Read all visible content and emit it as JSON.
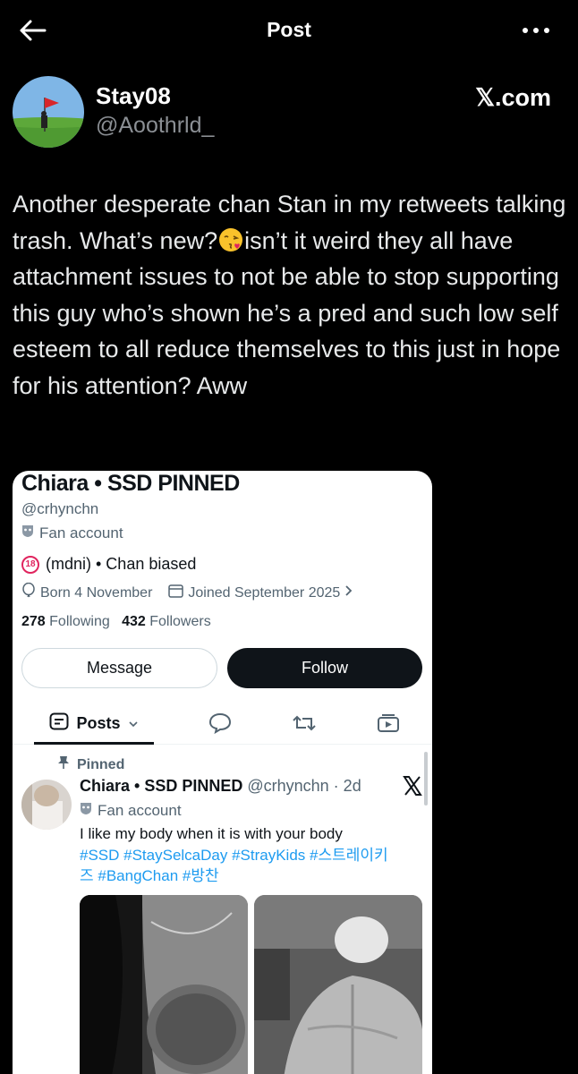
{
  "topbar": {
    "title": "Post"
  },
  "author": {
    "name": "Stay08",
    "handle": "@Aoothrld_"
  },
  "source": {
    "label": "𝕏.com"
  },
  "tweet": {
    "text_part1": "Another desperate chan Stan in my retweets talking trash. What’s new?",
    "emoji": "kissing-face-emoji",
    "text_part2": "isn’t it weird they all have attachment issues to not be able to stop supporting this guy who’s shown he’s a pred and such low self esteem to all reduce themselves to this just in hope for his attention? Aww"
  },
  "profile_card": {
    "name": "Chiara • SSD PINNED",
    "handle": "@crhynchn",
    "badge": "Fan account",
    "bio": "(mdni) • Chan biased",
    "born": "Born 4 November",
    "joined": "Joined September 2025",
    "following_count": "278",
    "following_label": "Following",
    "followers_count": "432",
    "followers_label": "Followers",
    "message_label": "Message",
    "follow_label": "Follow",
    "tabs": {
      "posts": "Posts"
    },
    "pinned_label": "Pinned",
    "pinned_tweet": {
      "name": "Chiara • SSD PINNED",
      "handle_time": "@crhynchn · 2d",
      "badge": "Fan account",
      "text": "I like my body when it is with your body",
      "hashtags_line1": "#SSD #StaySelcaDay #StrayKids #스트레이키",
      "hashtags_line2": "즈 #BangChan #방찬"
    }
  },
  "colors": {
    "background": "#000000",
    "text": "#e7e9ea",
    "muted": "#8b8f94",
    "link": "#1d9bf0",
    "card": "#ffffff"
  }
}
